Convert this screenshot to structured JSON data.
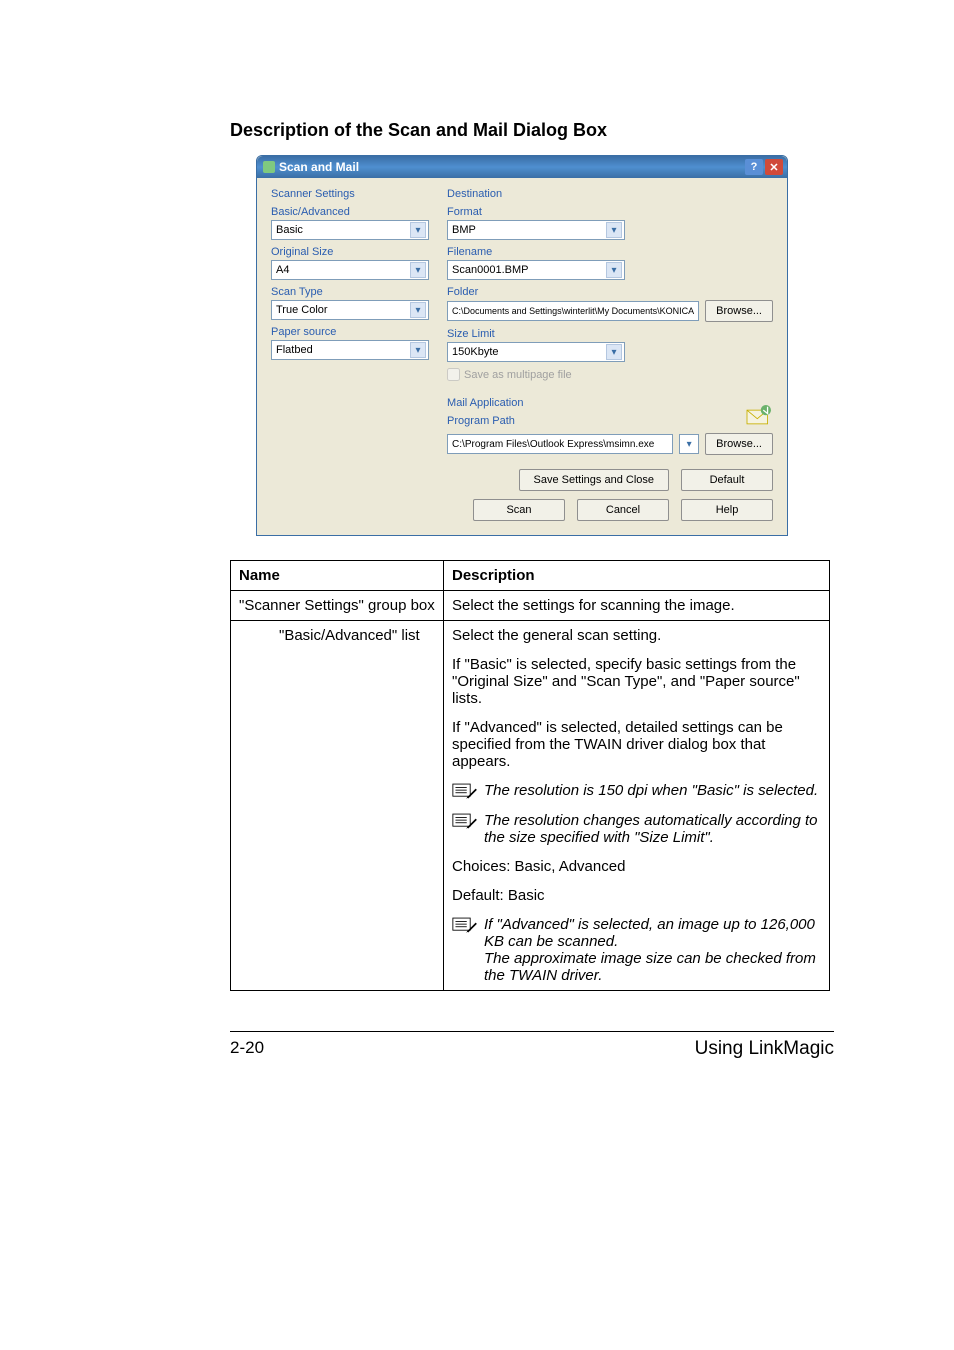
{
  "heading": "Description of the Scan and Mail Dialog Box",
  "dialog": {
    "title": "Scan and Mail",
    "help": "?",
    "close": "✕",
    "scanner_settings_title": "Scanner Settings",
    "basic_advanced_label": "Basic/Advanced",
    "basic_advanced_value": "Basic",
    "original_size_label": "Original Size",
    "original_size_value": "A4",
    "scan_type_label": "Scan Type",
    "scan_type_value": "True Color",
    "paper_source_label": "Paper source",
    "paper_source_value": "Flatbed",
    "destination_title": "Destination",
    "format_label": "Format",
    "format_value": "BMP",
    "filename_label": "Filename",
    "filename_value": "Scan0001.BMP",
    "folder_label": "Folder",
    "folder_value": "C:\\Documents and Settings\\winterlit\\My Documents\\KONICA",
    "browse1": "Browse...",
    "size_limit_label": "Size Limit",
    "size_limit_value": "150Kbyte",
    "save_multipage_label": "Save as multipage file",
    "mail_app_title": "Mail Application",
    "program_path_label": "Program Path",
    "program_path_value": "C:\\Program Files\\Outlook Express\\msimn.exe",
    "browse2": "Browse...",
    "save_settings_close": "Save Settings and Close",
    "default": "Default",
    "scan": "Scan",
    "cancel": "Cancel",
    "help_btn": "Help"
  },
  "table": {
    "name_header": "Name",
    "desc_header": "Description",
    "row1_name": "\"Scanner Settings\" group box",
    "row1_desc": "Select the settings for scanning the image.",
    "row2_name": "\"Basic/Advanced\" list",
    "row2": {
      "p1": "Select the general scan setting.",
      "p2": "If \"Basic\" is selected, specify basic settings from the \"Original Size\" and \"Scan Type\", and \"Paper source\" lists.",
      "p3": "If \"Advanced\" is selected, detailed settings can be specified from the TWAIN driver dialog box that appears.",
      "note1": "The resolution is 150 dpi when \"Basic\" is selected.",
      "note2": "The resolution changes automatically according to the size specified with \"Size Limit\".",
      "p4": "Choices: Basic, Advanced",
      "p5": "Default: Basic",
      "note3a": "If \"Advanced\" is selected, an image up to 126,000 KB can be scanned.",
      "note3b": "The approximate image size can be checked from the TWAIN driver."
    }
  },
  "footer": {
    "page": "2-20",
    "section": "Using LinkMagic"
  }
}
